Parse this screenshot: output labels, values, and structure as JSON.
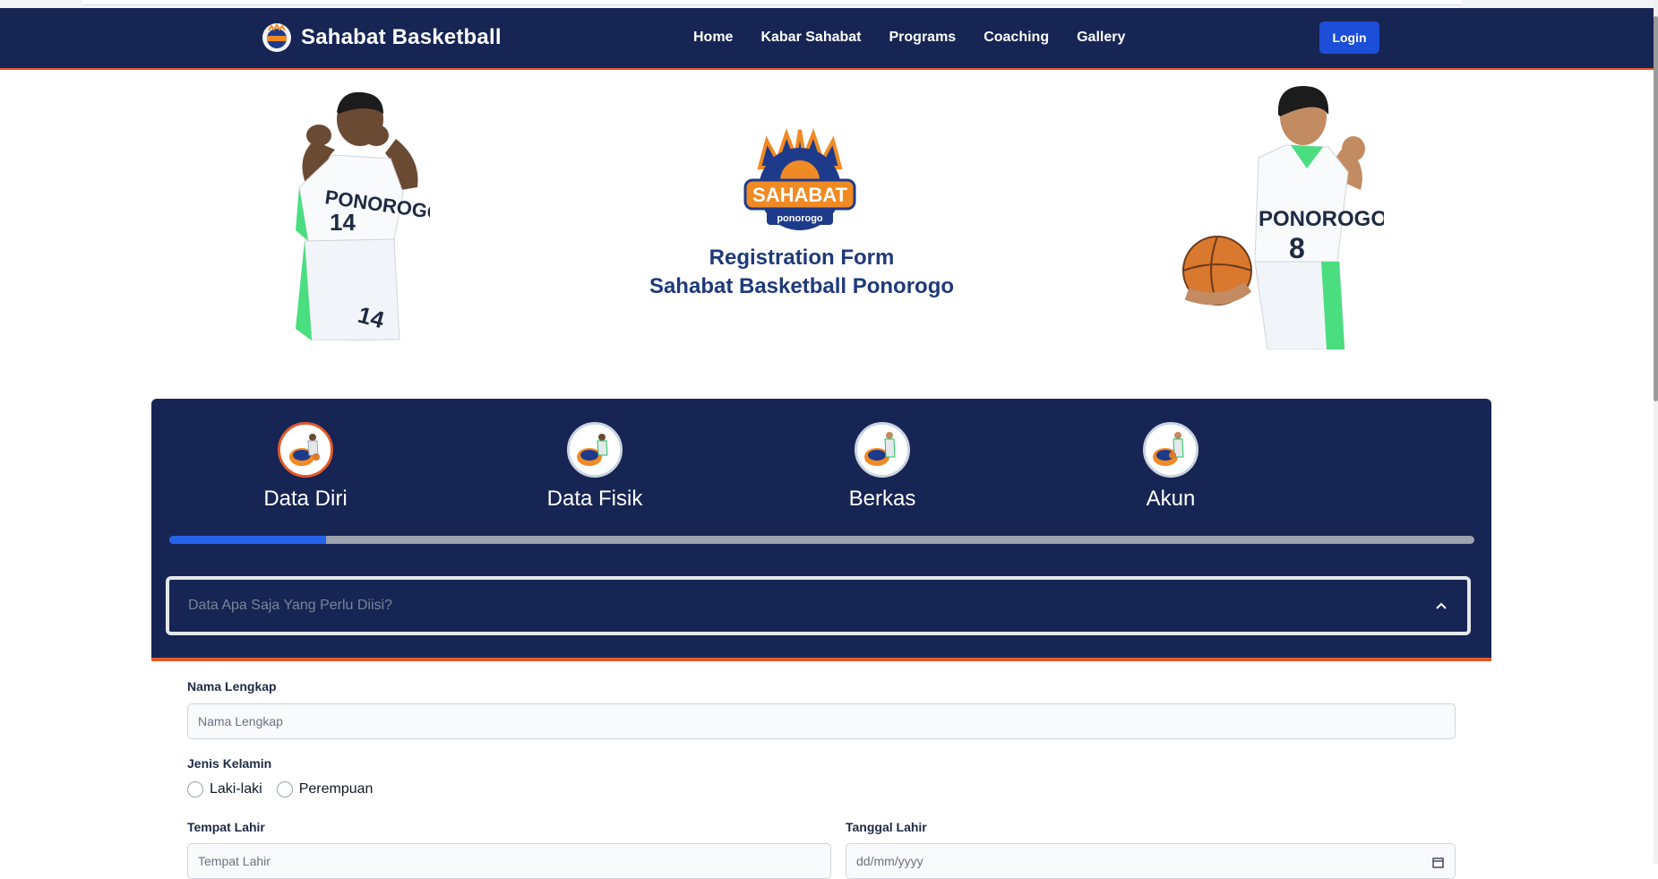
{
  "navbar": {
    "brand": "Sahabat Basketball",
    "links": [
      "Home",
      "Kabar Sahabat",
      "Programs",
      "Coaching",
      "Gallery"
    ],
    "login": "Login"
  },
  "hero": {
    "logo_text": "SAHABAT",
    "logo_subtext": "ponorogo",
    "title_line1": "Registration Form",
    "title_line2": "Sahabat Basketball Ponorogo",
    "left_player_jersey": "PONOROGO",
    "left_player_number": "14",
    "right_player_jersey": "PONOROGO",
    "right_player_number": "8"
  },
  "stepper": {
    "steps": [
      {
        "label": "Data Diri",
        "active": true
      },
      {
        "label": "Data Fisik",
        "active": false
      },
      {
        "label": "Berkas",
        "active": false
      },
      {
        "label": "Akun",
        "active": false
      }
    ],
    "progress": 0.12,
    "accordion_title": "Data Apa Saja Yang Perlu Diisi?"
  },
  "form": {
    "nama_label": "Nama Lengkap",
    "nama_placeholder": "Nama Lengkap",
    "gender_label": "Jenis Kelamin",
    "gender_options": [
      "Laki-laki",
      "Perempuan"
    ],
    "tempat_label": "Tempat Lahir",
    "tempat_placeholder": "Tempat Lahir",
    "tanggal_label": "Tanggal Lahir",
    "tanggal_placeholder": "dd/mm/yyyy"
  },
  "colors": {
    "navy": "#172554",
    "accent_orange": "#e25a2b",
    "button_blue": "#1d4ed8",
    "progress_blue": "#2563eb"
  }
}
